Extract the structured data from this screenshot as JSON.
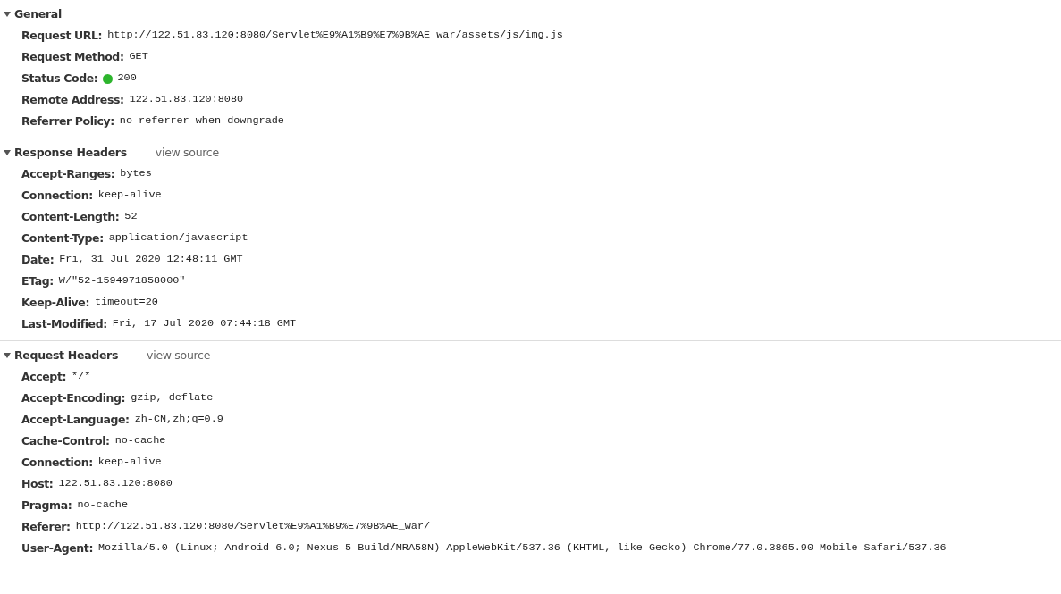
{
  "sections": [
    {
      "title": "General",
      "expanded": true,
      "rows": [
        {
          "name": "Request URL:",
          "value": "http://122.51.83.120:8080/Servlet%E9%A1%B9%E7%9B%AE_war/assets/js/img.js"
        },
        {
          "name": "Request Method:",
          "value": "GET"
        },
        {
          "name": "Status Code:",
          "value": "200",
          "kind": "status",
          "color": "#2db52d"
        },
        {
          "name": "Remote Address:",
          "value": "122.51.83.120:8080"
        },
        {
          "name": "Referrer Policy:",
          "value": "no-referrer-when-downgrade"
        }
      ]
    },
    {
      "title": "Response Headers",
      "expanded": true,
      "link": "view source",
      "rows": [
        {
          "name": "Accept-Ranges:",
          "value": "bytes"
        },
        {
          "name": "Connection:",
          "value": "keep-alive"
        },
        {
          "name": "Content-Length:",
          "value": "52"
        },
        {
          "name": "Content-Type:",
          "value": "application/javascript"
        },
        {
          "name": "Date:",
          "value": "Fri, 31 Jul 2020 12:48:11 GMT"
        },
        {
          "name": "ETag:",
          "value": "W/\"52-1594971858000\""
        },
        {
          "name": "Keep-Alive:",
          "value": "timeout=20"
        },
        {
          "name": "Last-Modified:",
          "value": "Fri, 17 Jul 2020 07:44:18 GMT"
        }
      ]
    },
    {
      "title": "Request Headers",
      "expanded": true,
      "link": "view source",
      "rows": [
        {
          "name": "Accept:",
          "value": "*/*"
        },
        {
          "name": "Accept-Encoding:",
          "value": "gzip, deflate"
        },
        {
          "name": "Accept-Language:",
          "value": "zh-CN,zh;q=0.9"
        },
        {
          "name": "Cache-Control:",
          "value": "no-cache"
        },
        {
          "name": "Connection:",
          "value": "keep-alive"
        },
        {
          "name": "Host:",
          "value": "122.51.83.120:8080"
        },
        {
          "name": "Pragma:",
          "value": "no-cache"
        },
        {
          "name": "Referer:",
          "value": "http://122.51.83.120:8080/Servlet%E9%A1%B9%E7%9B%AE_war/"
        },
        {
          "name": "User-Agent:",
          "value": "Mozilla/5.0 (Linux; Android 6.0; Nexus 5 Build/MRA58N) AppleWebKit/537.36 (KHTML, like Gecko) Chrome/77.0.3865.90 Mobile Safari/537.36"
        }
      ]
    }
  ]
}
